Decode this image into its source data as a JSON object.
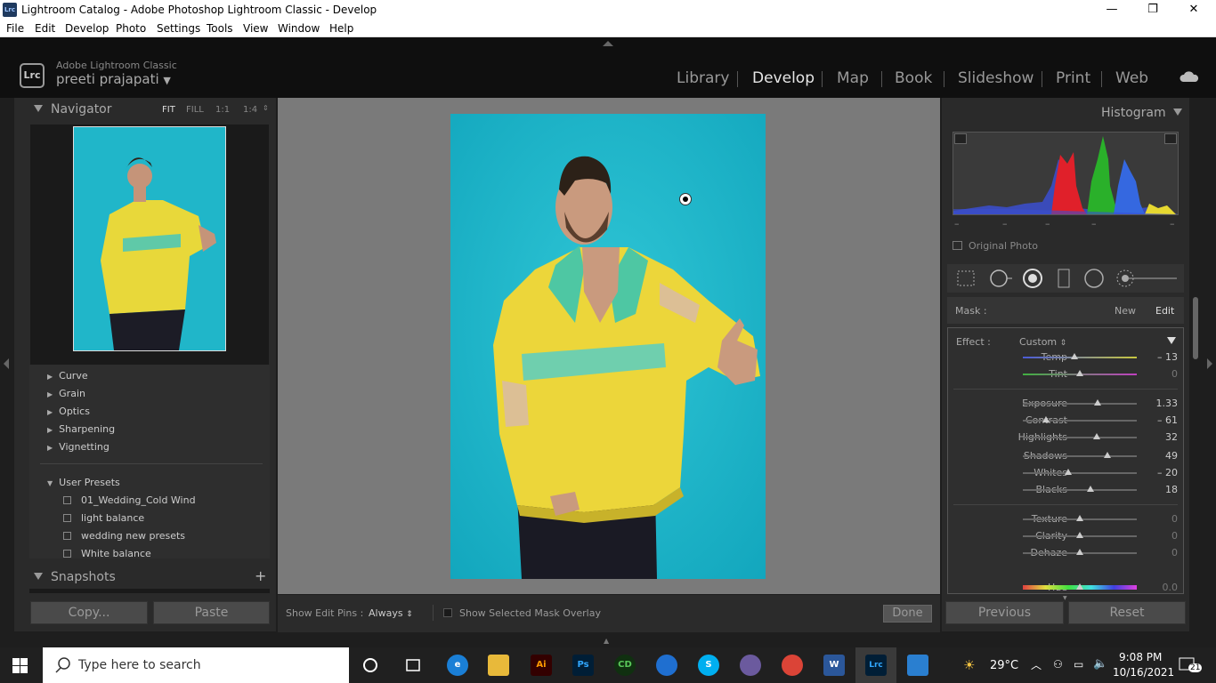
{
  "window": {
    "title": "Lightroom Catalog - Adobe Photoshop Lightroom Classic - Develop",
    "app_icon": "Lrc",
    "controls": [
      "—",
      "❐",
      "✕"
    ]
  },
  "menu": [
    "File",
    "Edit",
    "Develop",
    "Photo",
    "Settings",
    "Tools",
    "View",
    "Window",
    "Help"
  ],
  "identity": {
    "logo": "Lrc",
    "brand": "Adobe Lightroom Classic",
    "user": "preeti prajapati"
  },
  "modules": [
    "Library",
    "Develop",
    "Map",
    "Book",
    "Slideshow",
    "Print",
    "Web"
  ],
  "active_module": "Develop",
  "navigator": {
    "title": "Navigator",
    "zoom_options": [
      "FIT",
      "FILL",
      "1:1",
      "1:4"
    ]
  },
  "presets": {
    "groups": [
      "Curve",
      "Grain",
      "Optics",
      "Sharpening",
      "Vignetting"
    ],
    "user_presets_label": "User Presets",
    "user_presets": [
      "01_Wedding_Cold Wind",
      "light balance",
      "wedding new presets",
      "White balance"
    ]
  },
  "snapshots": {
    "title": "Snapshots",
    "add": "+"
  },
  "left_buttons": {
    "copy": "Copy...",
    "paste": "Paste"
  },
  "toolbar": {
    "show_edit_pins_label": "Show Edit Pins :",
    "show_edit_pins_value": "Always",
    "mask_overlay_label": "Show Selected Mask Overlay",
    "done": "Done"
  },
  "histogram": {
    "title": "Histogram",
    "original_photo": "Original Photo",
    "dashes": [
      "–",
      "–",
      "–",
      "–",
      "–"
    ]
  },
  "mask": {
    "label": "Mask :",
    "new": "New",
    "edit": "Edit"
  },
  "effect": {
    "label": "Effect :",
    "value": "Custom"
  },
  "sliders": [
    {
      "name": "Temp",
      "value": "– 13",
      "pos": 0.45
    },
    {
      "name": "Tint",
      "value": "0",
      "pos": 0.5
    },
    {
      "name": "Exposure",
      "value": "1.33",
      "pos": 0.66
    },
    {
      "name": "Contrast",
      "value": "– 61",
      "pos": 0.2
    },
    {
      "name": "Highlights",
      "value": "32",
      "pos": 0.65
    },
    {
      "name": "Shadows",
      "value": "49",
      "pos": 0.74
    },
    {
      "name": "Whites",
      "value": "– 20",
      "pos": 0.4
    },
    {
      "name": "Blacks",
      "value": "18",
      "pos": 0.59
    },
    {
      "name": "Texture",
      "value": "0",
      "pos": 0.5
    },
    {
      "name": "Clarity",
      "value": "0",
      "pos": 0.5
    },
    {
      "name": "Dehaze",
      "value": "0",
      "pos": 0.5
    },
    {
      "name": "Hue",
      "value": "0.0",
      "pos": 0.5
    }
  ],
  "right_buttons": {
    "previous": "Previous",
    "reset": "Reset"
  },
  "taskbar": {
    "search_placeholder": "Type here to search",
    "weather": "29°C",
    "time": "9:08 PM",
    "date": "10/16/2021",
    "notifications": "21"
  }
}
